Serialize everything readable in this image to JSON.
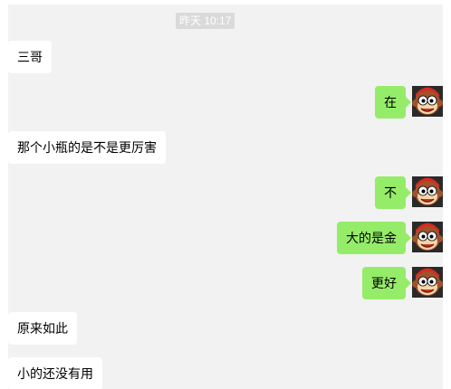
{
  "chat": {
    "timestamp": "昨天 10:17",
    "messages": [
      {
        "side": "incoming",
        "text": "三哥"
      },
      {
        "side": "outgoing",
        "text": "在",
        "avatar_icon": "monkey-avatar-icon"
      },
      {
        "side": "incoming",
        "text": "那个小瓶的是不是更厉害"
      },
      {
        "side": "outgoing",
        "text": "不",
        "avatar_icon": "monkey-avatar-icon"
      },
      {
        "side": "outgoing",
        "text": "大的是金",
        "avatar_icon": "monkey-avatar-icon"
      },
      {
        "side": "outgoing",
        "text": "更好",
        "avatar_icon": "monkey-avatar-icon"
      },
      {
        "side": "incoming",
        "text": "原来如此"
      },
      {
        "side": "incoming",
        "text": "小的还没有用"
      }
    ]
  },
  "colors": {
    "chat_background": "#f2f2f2",
    "outgoing_bubble": "#95ec69",
    "incoming_bubble": "#ffffff",
    "timestamp_background": "#dadada"
  }
}
